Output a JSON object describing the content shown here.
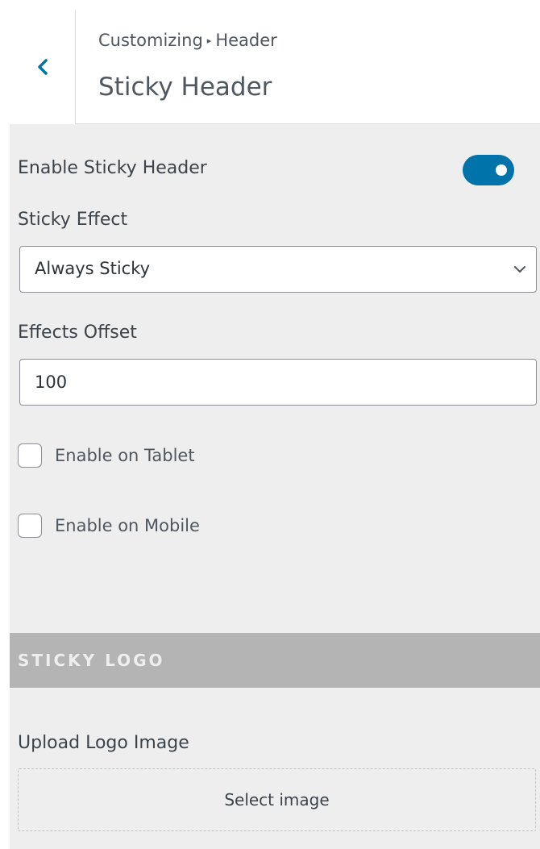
{
  "header": {
    "breadcrumb_root": "Customizing",
    "breadcrumb_separator": "▸",
    "breadcrumb_parent": "Header",
    "title": "Sticky Header"
  },
  "controls": {
    "enable_sticky_label": "Enable Sticky Header",
    "enable_sticky_on": true,
    "sticky_effect_label": "Sticky Effect",
    "sticky_effect_value": "Always Sticky",
    "effects_offset_label": "Effects Offset",
    "effects_offset_value": "100",
    "tablet_label": "Enable on Tablet",
    "tablet_checked": false,
    "mobile_label": "Enable on Mobile",
    "mobile_checked": false
  },
  "sticky_logo": {
    "section_title": "STICKY LOGO",
    "upload_label": "Upload Logo Image",
    "select_button": "Select image"
  },
  "colors": {
    "accent": "#0073aa",
    "panel_bg": "#eeeeee",
    "section_bg": "#b4b4b4"
  },
  "icons": {
    "back": "chevron-left-icon",
    "select_arrow": "chevron-down-icon"
  }
}
